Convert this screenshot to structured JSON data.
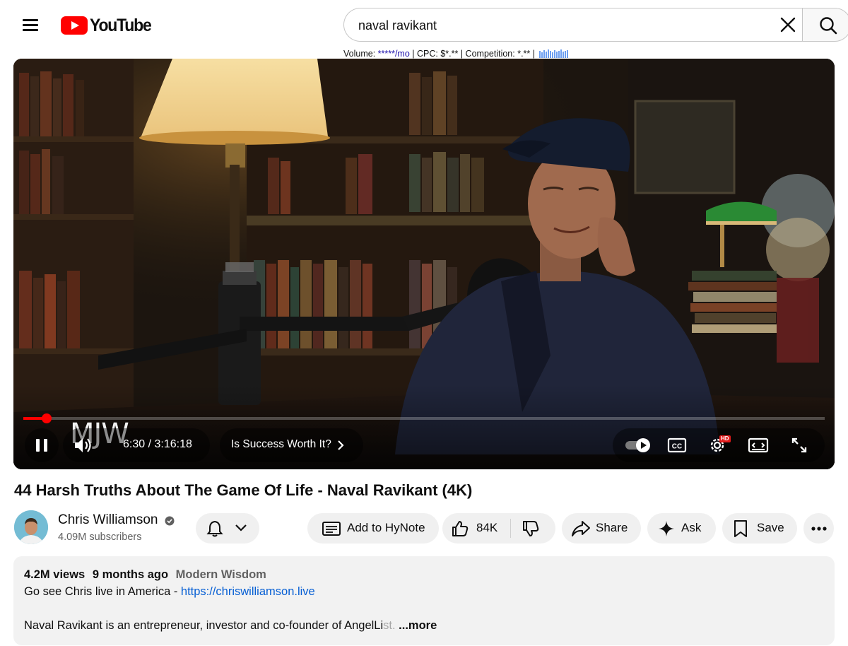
{
  "header": {
    "logo_text": "YouTube",
    "search_value": "naval ravikant",
    "seo": {
      "volume_label": "Volume: ",
      "volume_value": "*****/mo",
      "cpc": " | CPC: $*.** | Competition: *.** | "
    }
  },
  "player": {
    "current_time": "6:30",
    "duration": "3:16:18",
    "time_text": "6:30 / 3:16:18",
    "progress_fraction": 0.029,
    "chapter": "Is Success Worth It?",
    "watermark": "MJW",
    "hd_badge": "HD"
  },
  "video": {
    "title": "44 Harsh Truths About The Game Of Life - Naval Ravikant (4K)"
  },
  "channel": {
    "name": "Chris Williamson",
    "subscribers": "4.09M subscribers"
  },
  "actions": {
    "hynote": "Add to HyNote",
    "likes": "84K",
    "share": "Share",
    "ask": "Ask",
    "save": "Save"
  },
  "description": {
    "views": "4.2M views",
    "age": "9 months ago",
    "tag": "Modern Wisdom",
    "line1_text": "Go see Chris live in America - ",
    "line1_link": "https://chriswilliamson.live",
    "line2_text": "Naval Ravikant is an entrepreneur, investor and co-founder of AngelLi",
    "line2_fade": "st.",
    "more": "...more"
  },
  "colors": {
    "brand_red": "#ff0000",
    "link_blue": "#065fd4",
    "progress": "#ff0000"
  },
  "icons": [
    "menu-icon",
    "youtube-logo-icon",
    "clear-icon",
    "search-icon",
    "pause-icon",
    "volume-icon",
    "chevron-right-icon",
    "autoplay-toggle-icon",
    "captions-icon",
    "settings-icon",
    "theater-icon",
    "fullscreen-icon",
    "bell-icon",
    "chevron-down-icon",
    "hynote-icon",
    "thumbs-up-icon",
    "thumbs-down-icon",
    "share-icon",
    "sparkle-icon",
    "bookmark-icon",
    "more-horizontal-icon",
    "verified-icon"
  ]
}
